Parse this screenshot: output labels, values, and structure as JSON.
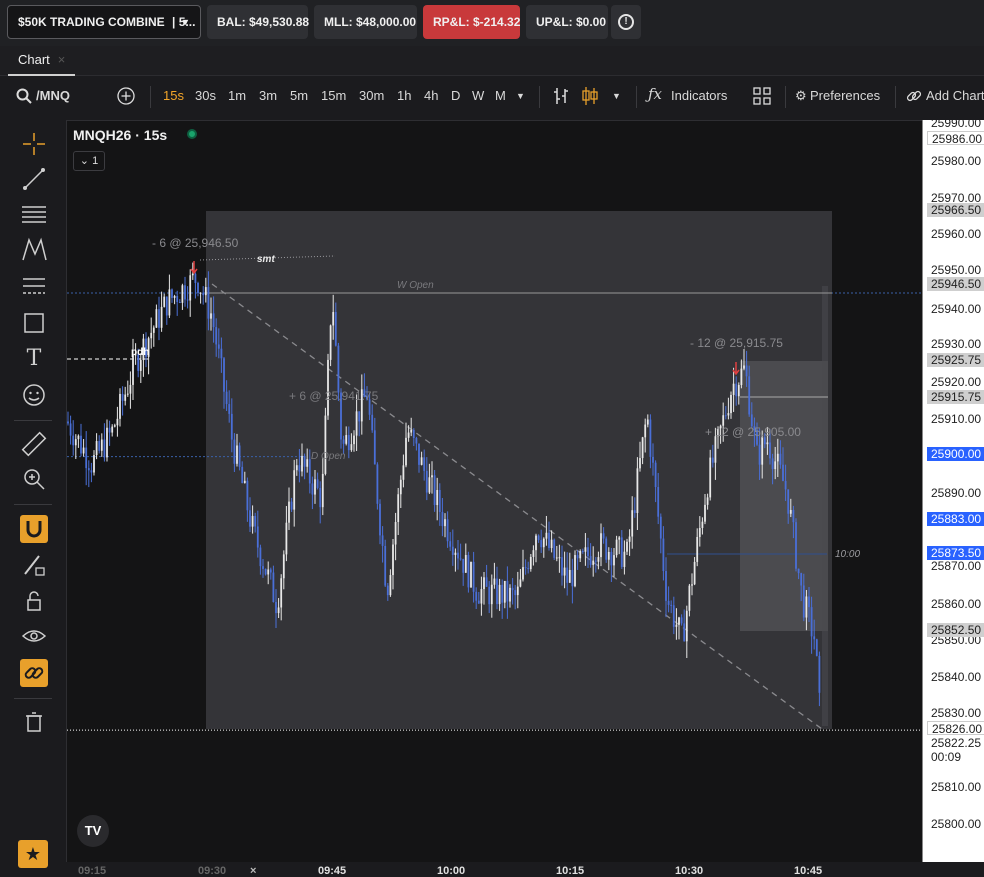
{
  "topbar": {
    "account": "$50K TRADING COMBINE",
    "account_suffix": "| 5...",
    "balance": "BAL: $49,530.88",
    "mll": "MLL: $48,000.00",
    "rpnl": "RP&L: $-214.32",
    "upnl": "UP&L: $0.00",
    "info_icon": "!"
  },
  "tabs": {
    "chart_tab": "Chart",
    "close": "×"
  },
  "toolbar": {
    "symbol": "/MNQ",
    "timeframes": [
      "15s",
      "30s",
      "1m",
      "3m",
      "5m",
      "15m",
      "30m",
      "1h",
      "4h",
      "D",
      "W",
      "M"
    ],
    "indicators": "Indicators",
    "preferences": "Preferences",
    "add_chart": "Add Chart"
  },
  "chart": {
    "title": "MNQH26 · 15s",
    "collapse_count": "1",
    "tv_logo": "TV",
    "annotations": {
      "sell_label": "- 6 @ 25,946.50",
      "smt": "smt",
      "w_open": "W Open",
      "pdh": "pdh",
      "buy6": "+ 6 @ 25,941.75",
      "d_open": "D Open",
      "sell12": "- 12 @ 25,915.75",
      "buy12": "+ 12 @ 25,905.00",
      "time_marker": "10:00"
    }
  },
  "price_axis": {
    "labels": [
      "25990.00",
      "25980.00",
      "25970.00",
      "25960.00",
      "25950.00",
      "25940.00",
      "25930.00",
      "25920.00",
      "25910.00",
      "25890.00",
      "25870.00",
      "25860.00",
      "25850.00",
      "25840.00",
      "25830.00",
      "25810.00",
      "25800.00"
    ],
    "tags": {
      "t1": "25986.00",
      "t2": "25966.50",
      "t3": "25946.50",
      "t4": "25925.75",
      "t5": "25915.75",
      "t6": "25900.00",
      "t7": "25883.00",
      "t8": "25873.50",
      "t9": "25852.50",
      "t10": "25826.00",
      "t11": "25822.25",
      "countdown": "00:09"
    }
  },
  "time_axis": {
    "labels": [
      "09:15",
      "09:30",
      "09:45",
      "10:00",
      "10:15",
      "10:30",
      "10:45"
    ],
    "close": "×"
  },
  "chart_data": {
    "type": "candlestick",
    "symbol": "MNQH26",
    "interval": "15s",
    "ylim": [
      25795,
      25992
    ],
    "levels": {
      "w_open": 25946.5,
      "d_open": 25900.0,
      "pdh": 25925.75,
      "last": 25822.25
    },
    "trades": [
      {
        "side": "sell",
        "qty": 6,
        "price": 25946.5
      },
      {
        "side": "buy",
        "qty": 6,
        "price": 25941.75
      },
      {
        "side": "sell",
        "qty": 12,
        "price": 25915.75
      },
      {
        "side": "buy",
        "qty": 12,
        "price": 25905.0
      }
    ]
  }
}
